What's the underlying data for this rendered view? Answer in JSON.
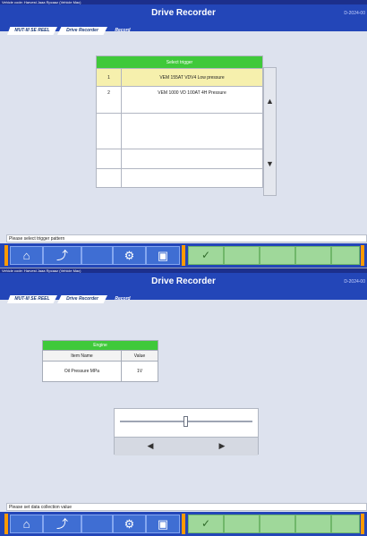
{
  "screen1": {
    "window_title": "Vehicle code: Harvest Jaaa Rpcaaz (Vehicle Mac)",
    "app_title": "Drive Recorder",
    "app_code": "D-2024-00",
    "tabs": [
      "MUT-III SE REEL",
      "Drive Recorder",
      "Record"
    ],
    "list": {
      "header": "Select trigger",
      "rows": [
        {
          "num": "1",
          "label": "VEM 155AT VDV4 Low pressure",
          "selected": true
        },
        {
          "num": "2",
          "label": "VEM 1000 VD 100AT 4H Pressure",
          "selected": false
        }
      ]
    },
    "status": "Please select trigger pattern",
    "footer": {
      "home_icon": "⌂",
      "back_icon": "⤴",
      "tool_icon": "⚙",
      "doc_icon": "▣",
      "check_icon": "✓"
    }
  },
  "screen2": {
    "window_title": "Vehicle code: Harvest Jaaa Rpcaaz (Vehicle Mac)",
    "app_title": "Drive Recorder",
    "app_code": "D-2024-00",
    "tabs": [
      "MUT-III SE REEL",
      "Drive Recorder",
      "Record"
    ],
    "table": {
      "caption": "Engine",
      "headers": [
        "Item Name",
        "Value"
      ],
      "row": [
        "Oil Pressure MPa",
        "1V"
      ]
    },
    "slider_value": 0.5,
    "status": "Please set data collection value",
    "footer": {
      "home_icon": "⌂",
      "back_icon": "⤴",
      "tool_icon": "⚙",
      "doc_icon": "▣",
      "check_icon": "✓"
    }
  },
  "arrows": {
    "up": "▲",
    "down": "▼",
    "left": "◀",
    "right": "▶"
  }
}
